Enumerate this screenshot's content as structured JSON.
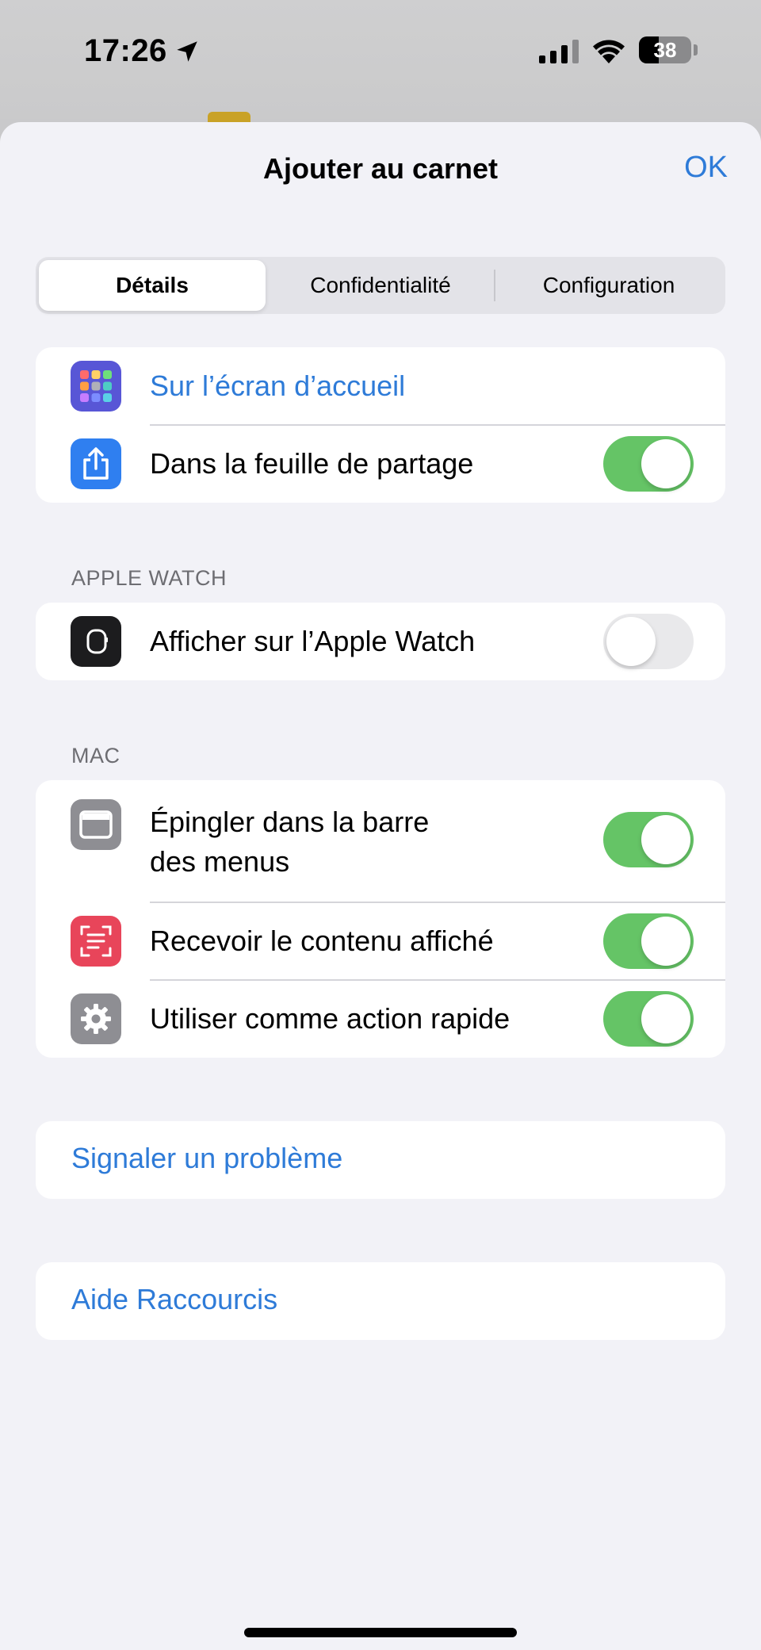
{
  "status_bar": {
    "time": "17:26",
    "battery_level": "38",
    "battery_fraction": 0.38
  },
  "sheet": {
    "title": "Ajouter au carnet",
    "ok_label": "OK"
  },
  "tabs": [
    {
      "label": "Détails",
      "active": true
    },
    {
      "label": "Confidentialité",
      "active": false
    },
    {
      "label": "Configuration",
      "active": false
    }
  ],
  "general": {
    "home_screen_label": "Sur l’écran d’accueil",
    "share_sheet_label": "Dans la feuille de partage",
    "share_sheet_on": true
  },
  "apple_watch": {
    "header": "APPLE WATCH",
    "show_label": "Afficher sur l’Apple Watch",
    "show_on": false
  },
  "mac": {
    "header": "MAC",
    "pin_label_line1": "Épingler dans la barre",
    "pin_label_line2": "des menus",
    "pin_on": true,
    "receive_label": "Recevoir le contenu affiché",
    "receive_on": true,
    "quick_action_label": "Utiliser comme action rapide",
    "quick_action_on": true
  },
  "links": {
    "report_problem": "Signaler un problème",
    "help": "Aide Raccourcis"
  },
  "colors": {
    "accent": "#2e7bd8",
    "toggle_on": "#65c466",
    "toggle_off": "#e9e9eb",
    "home_screen_icon": "#5856d6",
    "share_icon": "#2f7ff0",
    "watch_icon": "#1c1c1e",
    "menubar_icon": "#8e8e93",
    "receive_icon": "#e8455a",
    "gear_icon": "#8e8e93"
  }
}
